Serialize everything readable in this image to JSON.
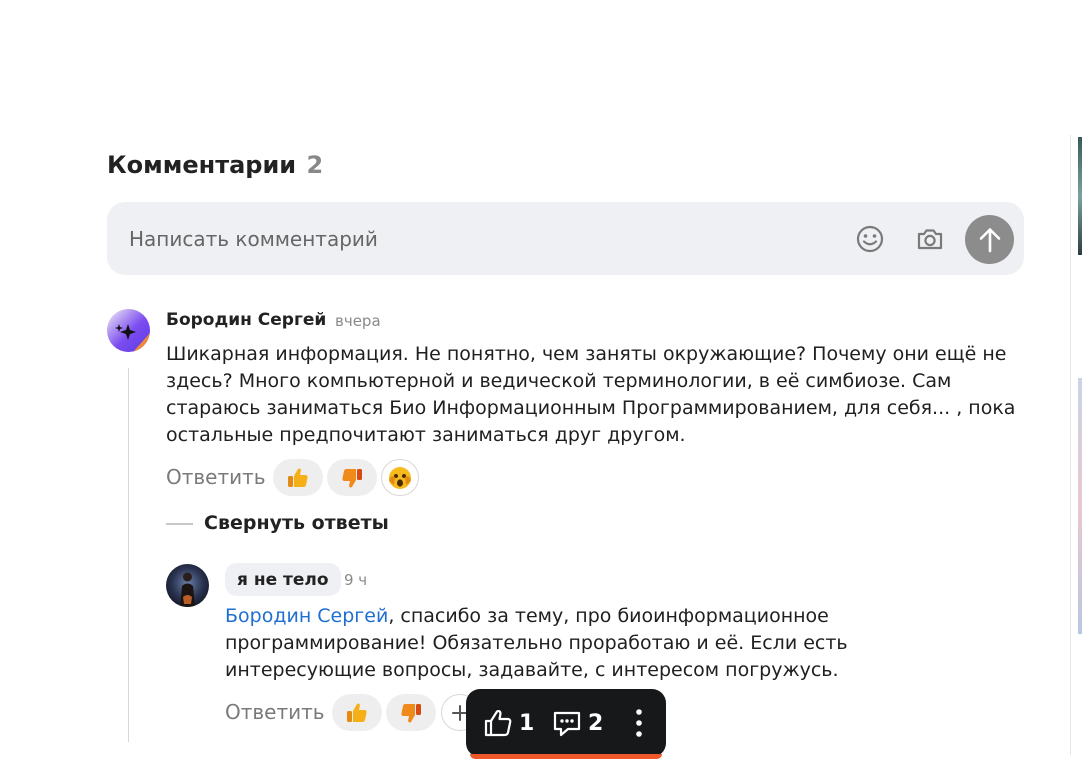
{
  "comments_header": {
    "title": "Комментарии",
    "count": "2"
  },
  "composer": {
    "placeholder": "Написать комментарий",
    "emoji_icon": "smile-icon",
    "photo_icon": "camera-icon",
    "send_icon": "arrow-up-icon"
  },
  "comments": [
    {
      "author": "Бородин Сергей",
      "time": "вчера",
      "text": "Шикарная информация. Не понятно, чем заняты окружающие? Почему они ещё не здесь? Много компьютерной и ведической терминологии, в её симбиозе. Сам стараюсь заниматься Био Информационным Программированием, для себя... , пока остальные предпочитают заниматься друг другом.",
      "reply_label": "Ответить",
      "reactions": [
        "thumbs-up",
        "thumbs-down",
        "shocked-face"
      ],
      "collapse_label": "Свернуть ответы"
    }
  ],
  "reply": {
    "author": "я не тело",
    "time": "9 ч",
    "mention": "Бородин Сергей",
    "text": ", спасибо за тему, про биоинформационное программирование! Обязательно проработаю и её. Если есть интересующие вопросы, задавайте, с интересом погружусь.",
    "reply_label": "Ответить",
    "reactions": [
      "thumbs-up",
      "thumbs-down",
      "add-reaction"
    ]
  },
  "bottom_bar": {
    "likes": "1",
    "comments": "2",
    "like_icon": "thumbs-up-outline-icon",
    "comment_icon": "comment-icon",
    "more_icon": "more-vertical-icon",
    "accent_color": "#f0582a"
  }
}
